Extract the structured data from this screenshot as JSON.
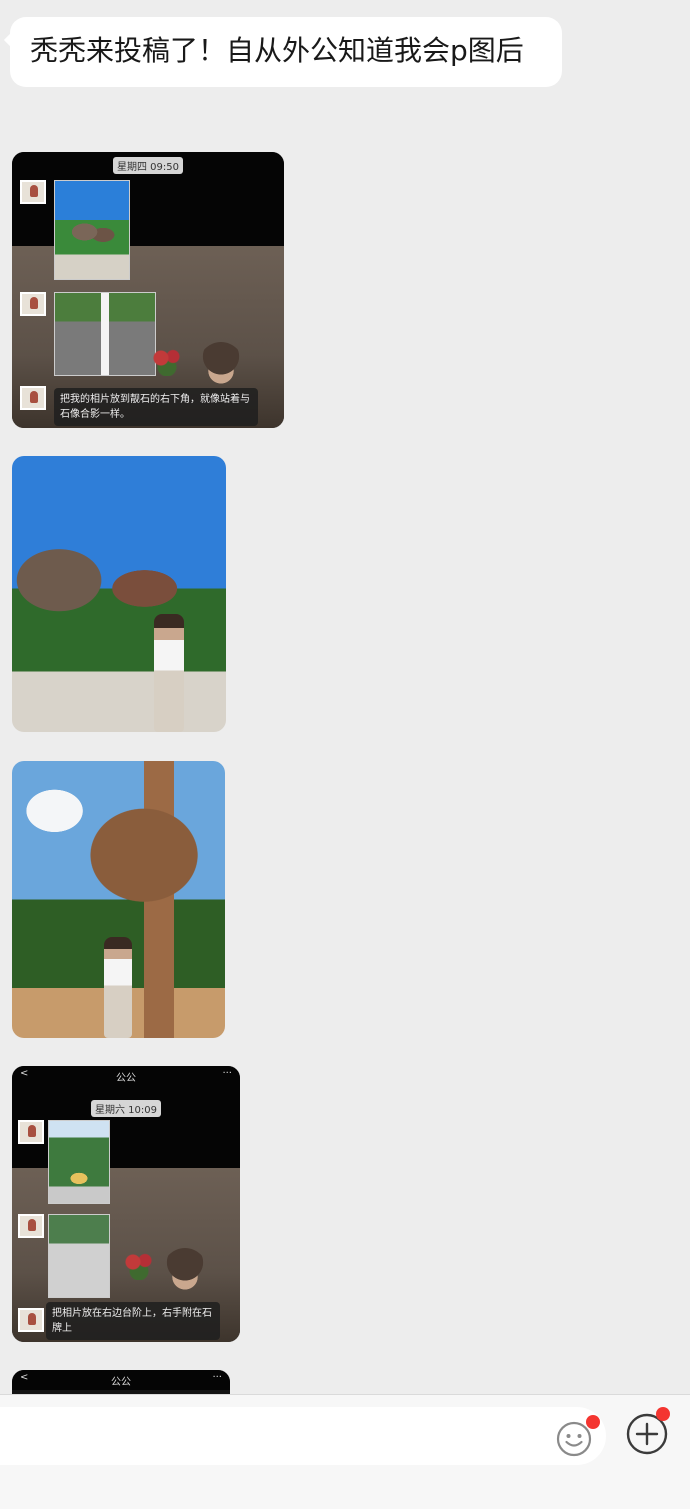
{
  "message_text": "秃秃来投稿了！自从外公知道我会p图后",
  "shot1": {
    "time_chip": "星期四 09:50",
    "caption": "把我的相片放到靓石的右下角，就像站着与石像合影一样。"
  },
  "shot2": {
    "nav_back": "<",
    "nav_title": "公公",
    "nav_more": "···",
    "time_chip": "星期六 10:09",
    "caption": "把相片放在右边台阶上，右手附在石牌上"
  },
  "shot3": {
    "nav_back": "<",
    "nav_title": "公公",
    "nav_more": "···"
  },
  "input_bar": {
    "placeholder": ""
  },
  "icons": {
    "emoji": "emoji-icon",
    "plus": "plus-icon",
    "badge_color": "#f43530"
  }
}
